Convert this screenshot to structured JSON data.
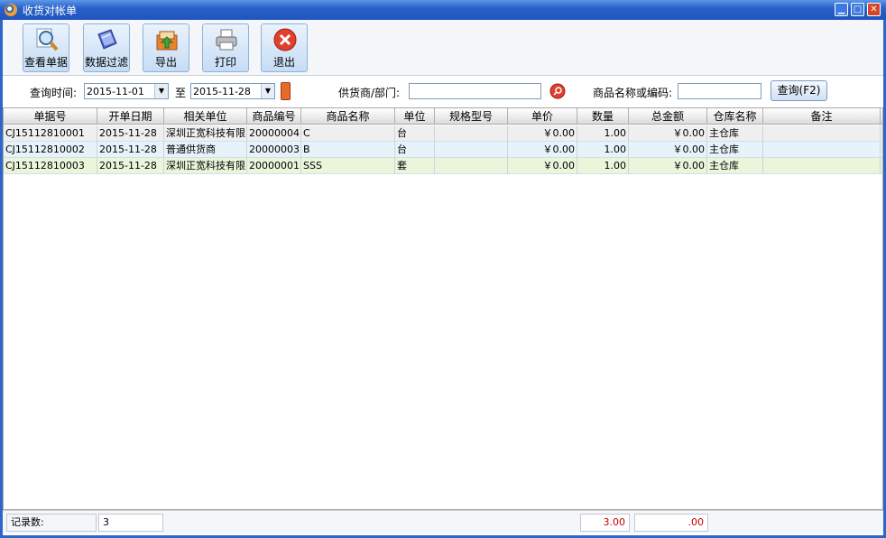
{
  "window": {
    "title": "收货对帐单",
    "min_glyph": "▁",
    "max_glyph": "□",
    "close_glyph": "✕"
  },
  "toolbar": {
    "view_label": "查看单据",
    "filter_label": "数据过滤",
    "export_label": "导出",
    "print_label": "打印",
    "exit_label": "退出"
  },
  "filter": {
    "query_time_label": "查询时间:",
    "date_from": "2015-11-01",
    "to_label": "至",
    "date_to": "2015-11-28",
    "supplier_label": "供货商/部门:",
    "supplier_value": "",
    "product_label": "商品名称或编码:",
    "product_value": "",
    "query_button": "查询(F2)"
  },
  "table": {
    "columns": [
      "单据号",
      "开单日期",
      "相关单位",
      "商品编号",
      "商品名称",
      "单位",
      "规格型号",
      "单价",
      "数量",
      "总金额",
      "仓库名称",
      "备注"
    ],
    "rows": [
      [
        "CJ15112810001",
        "2015-11-28",
        "深圳正宽科技有限",
        "20000004",
        "C",
        "台",
        "",
        "￥0.00",
        "1.00",
        "￥0.00",
        "主仓库",
        ""
      ],
      [
        "CJ15112810002",
        "2015-11-28",
        "普通供货商",
        "20000003",
        "B",
        "台",
        "",
        "￥0.00",
        "1.00",
        "￥0.00",
        "主仓库",
        ""
      ],
      [
        "CJ15112810003",
        "2015-11-28",
        "深圳正宽科技有限",
        "20000001",
        "SSS",
        "套",
        "",
        "￥0.00",
        "1.00",
        "￥0.00",
        "主仓库",
        ""
      ]
    ],
    "row_colors": [
      "#efefef",
      "#e6f3fa",
      "#eaf5dc"
    ]
  },
  "status": {
    "record_label": "记录数:",
    "record_count": "3",
    "total_qty": "3.00",
    "total_amount": ".00"
  },
  "colors": {
    "accent_title": "#2a62c8",
    "exit_red": "#d5452a",
    "total_red": "#c00000"
  }
}
